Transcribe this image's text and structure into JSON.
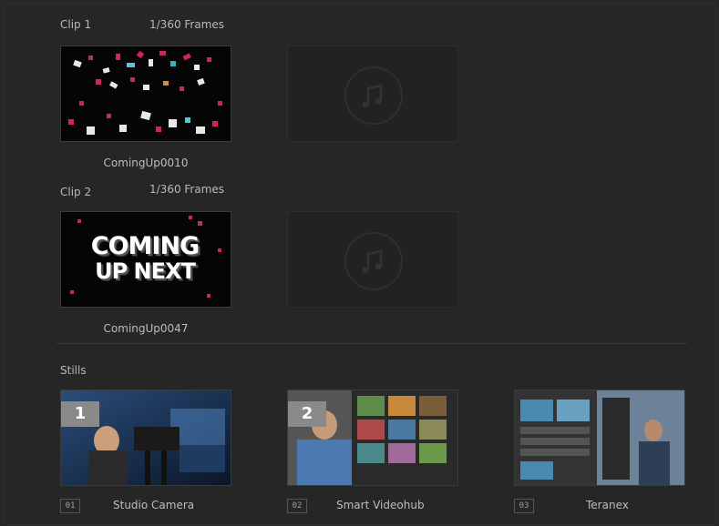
{
  "clip1": {
    "label": "Clip 1",
    "frames": "1/360 Frames",
    "clip_name": "ComingUp0010"
  },
  "clip2": {
    "label": "Clip 2",
    "frames": "1/360 Frames",
    "clip_name": "ComingUp0047",
    "graphic_text": [
      "COMING",
      "UP NEXT"
    ]
  },
  "stills": {
    "label": "Stills",
    "items": [
      {
        "index": "01",
        "name": "Studio Camera",
        "badge": "1"
      },
      {
        "index": "02",
        "name": "Smart Videohub",
        "badge": "2"
      },
      {
        "index": "03",
        "name": "Teranex",
        "badge": ""
      }
    ]
  },
  "colors": {
    "background": "#262626",
    "text": "#b9b9b9",
    "badge": "#8a8a8a"
  },
  "icons": {
    "audio_slot": "music-note-icon"
  }
}
